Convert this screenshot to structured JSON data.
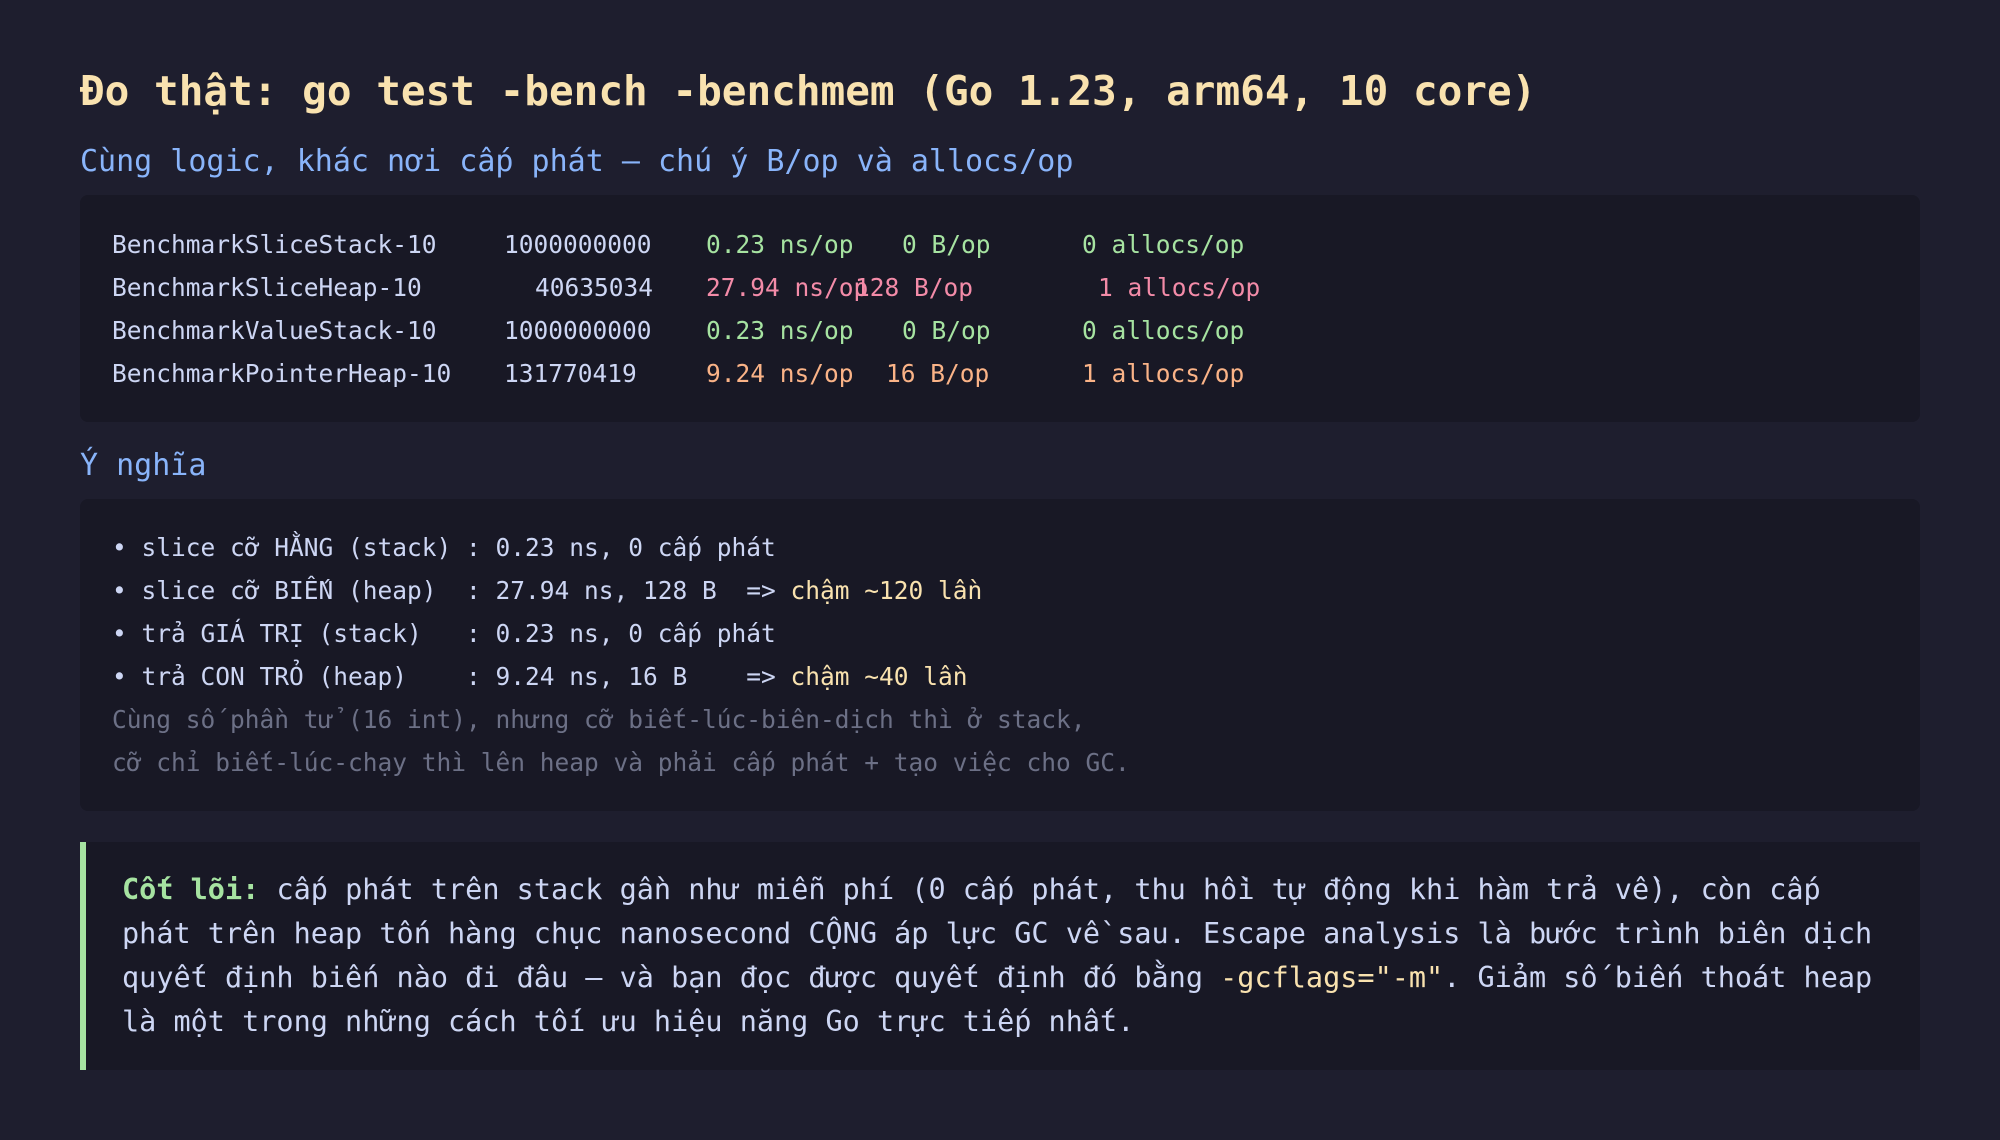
{
  "title": "Đo thật: go test -bench -benchmem (Go 1.23, arm64, 10 core)",
  "bench_section": {
    "heading": "Cùng logic, khác nơi cấp phát — chú ý B/op và allocs/op",
    "rows": [
      {
        "name": "BenchmarkSliceStack-10",
        "iterations": "1000000000",
        "ns": "0.23 ns/op",
        "bytes": "0 B/op",
        "allocs": "0 allocs/op",
        "color": "#a6e3a1"
      },
      {
        "name": "BenchmarkSliceHeap-10",
        "iterations": "40635034",
        "ns": "27.94 ns/op",
        "bytes": "128 B/op",
        "allocs": "1 allocs/op",
        "color": "#f38ba8"
      },
      {
        "name": "BenchmarkValueStack-10",
        "iterations": "1000000000",
        "ns": "0.23 ns/op",
        "bytes": "0 B/op",
        "allocs": "0 allocs/op",
        "color": "#a6e3a1"
      },
      {
        "name": "BenchmarkPointerHeap-10",
        "iterations": "131770419",
        "ns": "9.24 ns/op",
        "bytes": "16 B/op",
        "allocs": "1 allocs/op",
        "color": "#fab387"
      }
    ]
  },
  "meaning_section": {
    "heading": "Ý nghĩa",
    "items": [
      {
        "text": "• slice cỡ HẰNG (stack) : 0.23 ns, 0 cấp phát",
        "highlight": ""
      },
      {
        "text": "• slice cỡ BIẾN (heap)  : 27.94 ns, 128 B  => ",
        "highlight": "chậm ~120 lần"
      },
      {
        "text": "• trả GIÁ TRỊ (stack)   : 0.23 ns, 0 cấp phát",
        "highlight": ""
      },
      {
        "text": "• trả CON TRỎ (heap)    : 9.24 ns, 16 B    => ",
        "highlight": "chậm ~40 lần"
      }
    ],
    "notes": [
      "Cùng số phần tử (16 int), nhưng cỡ biết-lúc-biên-dịch thì ở stack,",
      "cỡ chỉ biết-lúc-chạy thì lên heap và phải cấp phát + tạo việc cho GC."
    ]
  },
  "callout": {
    "label": "Cốt lõi:",
    "text_before": " cấp phát trên stack gần như miễn phí (0 cấp phát, thu hồi tự động khi hàm trả về), còn cấp phát trên heap tốn hàng chục nanosecond CỘNG áp lực GC về sau. Escape analysis là bước trình biên dịch quyết định biến nào đi đâu — và bạn đọc được quyết định đó bằng ",
    "code": "-gcflags=\"-m\"",
    "text_after": ". Giảm số biến thoát heap là một trong những cách tối ưu hiệu năng Go trực tiếp nhất."
  },
  "colors": {
    "background": "#1e1e2e",
    "panel": "#181825",
    "title": "#f9e2af",
    "heading": "#89b4fa",
    "fast": "#a6e3a1",
    "slow": "#f38ba8",
    "medium": "#fab387",
    "muted": "#6c7086"
  }
}
